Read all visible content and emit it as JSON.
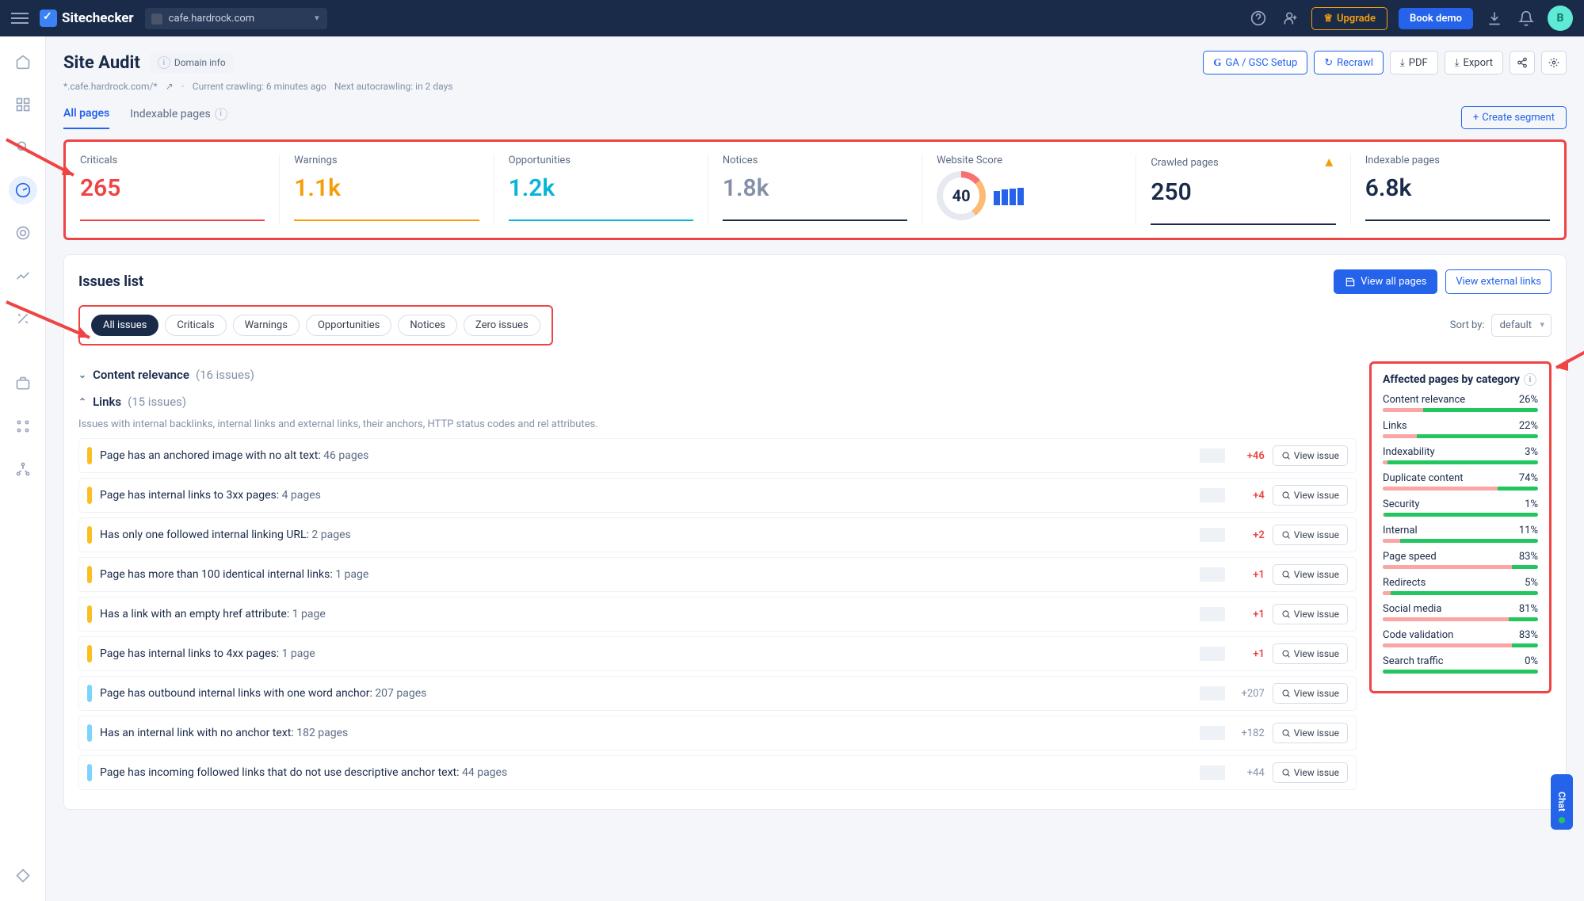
{
  "topbar": {
    "brand": "Sitechecker",
    "site": "cafe.hardrock.com",
    "upgrade": "Upgrade",
    "book": "Book demo",
    "avatar": "B"
  },
  "header": {
    "title": "Site Audit",
    "domain_info": "Domain info",
    "ga_btn": "GA / GSC Setup",
    "recrawl": "Recrawl",
    "pdf": "PDF",
    "export": "Export",
    "path": "*.cafe.hardrock.com/*",
    "crawl": "Current crawling: 6 minutes ago",
    "next": "Next autocrawling: in 2 days"
  },
  "tabs": {
    "all_pages": "All pages",
    "indexable": "Indexable pages",
    "create": "Create segment"
  },
  "stats": {
    "criticals_label": "Criticals",
    "criticals_value": "265",
    "warnings_label": "Warnings",
    "warnings_value": "1.1k",
    "opps_label": "Opportunities",
    "opps_value": "1.2k",
    "notices_label": "Notices",
    "notices_value": "1.8k",
    "score_label": "Website Score",
    "score_value": "40",
    "crawled_label": "Crawled pages",
    "crawled_value": "250",
    "indexable_label": "Indexable pages",
    "indexable_value": "6.8k"
  },
  "issues": {
    "title": "Issues list",
    "view_all": "View all pages",
    "view_external": "View external links",
    "filters": [
      "All issues",
      "Criticals",
      "Warnings",
      "Opportunities",
      "Notices",
      "Zero issues"
    ],
    "sort_label": "Sort by:",
    "sort_value": "default",
    "groups": [
      {
        "name": "Content relevance",
        "count": "(16 issues)",
        "collapsed": true
      },
      {
        "name": "Links",
        "count": "(15 issues)",
        "collapsed": false,
        "desc": "Issues with internal backlinks, internal links and external links, their anchors, HTTP status codes and rel attributes.",
        "items": [
          {
            "sev": "warn",
            "title": "Page has an anchored image with no alt text:",
            "pages": "46 pages",
            "delta": "+46",
            "warn": true
          },
          {
            "sev": "warn",
            "title": "Page has internal links to 3xx pages:",
            "pages": "4 pages",
            "delta": "+4",
            "warn": true
          },
          {
            "sev": "warn",
            "title": "Has only one followed internal linking URL:",
            "pages": "2 pages",
            "delta": "+2",
            "warn": true
          },
          {
            "sev": "warn",
            "title": "Page has more than 100 identical internal links:",
            "pages": "1 page",
            "delta": "+1",
            "warn": true
          },
          {
            "sev": "warn",
            "title": "Has a link with an empty href attribute:",
            "pages": "1 page",
            "delta": "+1",
            "warn": true
          },
          {
            "sev": "warn",
            "title": "Page has internal links to 4xx pages:",
            "pages": "1 page",
            "delta": "+1",
            "warn": true
          },
          {
            "sev": "notice",
            "title": "Page has outbound internal links with one word anchor:",
            "pages": "207 pages",
            "delta": "+207",
            "warn": false
          },
          {
            "sev": "notice",
            "title": "Has an internal link with no anchor text:",
            "pages": "182 pages",
            "delta": "+182",
            "warn": false
          },
          {
            "sev": "notice",
            "title": "Page has incoming followed links that do not use descriptive anchor text:",
            "pages": "44 pages",
            "delta": "+44",
            "warn": false
          }
        ]
      }
    ],
    "view_issue": "View issue"
  },
  "affected": {
    "title": "Affected pages by category",
    "cats": [
      {
        "name": "Content relevance",
        "pct": "26%",
        "red": 26
      },
      {
        "name": "Links",
        "pct": "22%",
        "red": 22
      },
      {
        "name": "Indexability",
        "pct": "3%",
        "red": 3
      },
      {
        "name": "Duplicate content",
        "pct": "74%",
        "red": 74
      },
      {
        "name": "Security",
        "pct": "1%",
        "red": 1
      },
      {
        "name": "Internal",
        "pct": "11%",
        "red": 11
      },
      {
        "name": "Page speed",
        "pct": "83%",
        "red": 83
      },
      {
        "name": "Redirects",
        "pct": "5%",
        "red": 5
      },
      {
        "name": "Social media",
        "pct": "81%",
        "red": 81
      },
      {
        "name": "Code validation",
        "pct": "83%",
        "red": 83
      },
      {
        "name": "Search traffic",
        "pct": "0%",
        "red": 0
      }
    ]
  },
  "chat": "Chat"
}
